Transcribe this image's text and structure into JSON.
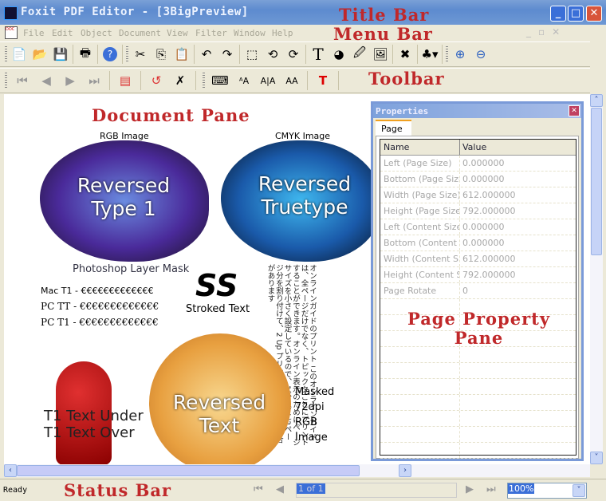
{
  "window": {
    "title": "Foxit PDF Editor - [3BigPreview]",
    "controls": [
      "minimize",
      "maximize",
      "close"
    ]
  },
  "annotations": {
    "title_bar": "Title Bar",
    "menu_bar": "Menu Bar",
    "toolbar": "Toolbar",
    "document_pane": "Document Pane",
    "page_property_pane_1": "Page Property",
    "page_property_pane_2": "Pane",
    "status_bar": "Status Bar"
  },
  "menu": [
    "File",
    "Edit",
    "Object",
    "Document",
    "View",
    "Filter",
    "Window",
    "Help"
  ],
  "toolbar1": [
    "new",
    "open",
    "save",
    "print",
    "help",
    "cut",
    "copy",
    "paste",
    "undo",
    "redo",
    "select",
    "rotate-left",
    "rotate-right",
    "text",
    "color",
    "edit-image",
    "insert-image",
    "delete",
    "objects",
    "zoom-in",
    "zoom-out"
  ],
  "toolbar2": [
    "first-page",
    "previous-page",
    "next-page",
    "last-page",
    "properties",
    "rotate",
    "delete-page",
    "keyboard",
    "text-tool-1",
    "text-tool-2",
    "text-tool-3",
    "add-text"
  ],
  "document": {
    "rgb_label": "RGB Image",
    "cmyk_label": "CMYK Image",
    "rev_t1_a": "Reversed",
    "rev_t1_b": "Type 1",
    "rev_tt_a": "Reversed",
    "rev_tt_b": "Truetype",
    "layer_mask": "Photoshop Layer Mask",
    "mac_t1": "Mac T1 - €€€€€€€€€€€€€",
    "pc_tt": "PC TT - €€€€€€€€€€€€€",
    "pc_t1": "PC T1 - €€€€€€€€€€€€€",
    "ss": "SS",
    "stroked": "Stroked Text",
    "japanese": "オンラインガイドのプリント このオンラインガイドは、全ページだけでなく、トピックタごとにプリントすることができます。オンライン表示のためにページサイズを小さく設定しているので、1ページに2ページ分を割り付けて、2 Up プリントした方がよい場合があります",
    "t1_under": "T1 Text Under",
    "t1_over": "T1 Text Over",
    "rev_text_a": "Reversed",
    "rev_text_b": "Text",
    "masked": [
      "Masked",
      "72dpi",
      "RGB",
      "Image"
    ]
  },
  "properties": {
    "title": "Properties",
    "tab": "Page",
    "columns": [
      "Name",
      "Value"
    ],
    "rows": [
      [
        "Left (Page Size)",
        "0.000000"
      ],
      [
        "Bottom (Page Size)",
        "0.000000"
      ],
      [
        "Width (Page Size)",
        "612.000000"
      ],
      [
        "Height (Page Size)",
        "792.000000"
      ],
      [
        "Left (Content Size)",
        "0.000000"
      ],
      [
        "Bottom (Content Size)",
        "0.000000"
      ],
      [
        "Width (Content Size)",
        "612.000000"
      ],
      [
        "Height (Content Size)",
        "792.000000"
      ],
      [
        "Page Rotate",
        "0"
      ]
    ]
  },
  "status": {
    "text": "Ready",
    "page": "1 of 1",
    "zoom": "100%"
  }
}
